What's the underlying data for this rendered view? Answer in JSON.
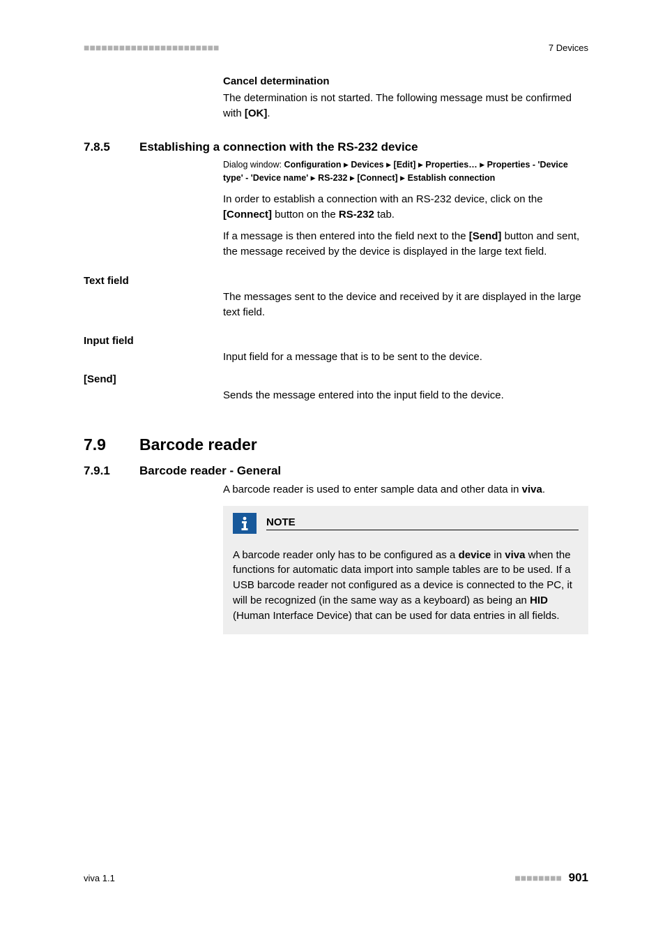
{
  "header": {
    "marks": "■■■■■■■■■■■■■■■■■■■■■■■",
    "right": "7 Devices"
  },
  "cancel": {
    "title": "Cancel determination",
    "body_before": "The determination is not started. The following message must be confirmed with ",
    "ok": "[OK]",
    "body_after": "."
  },
  "sec785": {
    "num": "7.8.5",
    "title": "Establishing a connection with the RS-232 device",
    "dialog_prefix": "Dialog window: ",
    "d1": "Configuration",
    "d2": "Devices",
    "d3": "[Edit]",
    "d4": "Properties…",
    "d5": "Properties - 'Device type' - 'Device name'",
    "d6": "RS-232",
    "d7": "[Connect]",
    "d8": "Establish connection",
    "p1_before": "In order to establish a connection with an RS-232 device, click on the ",
    "p1_connect": "[Connect]",
    "p1_mid": " button on the ",
    "p1_tab": "RS-232",
    "p1_after": " tab.",
    "p2_before": "If a message is then entered into the field next to the ",
    "p2_send": "[Send]",
    "p2_after": " button and sent, the message received by the device is displayed in the large text field."
  },
  "textfield": {
    "label": "Text field",
    "body": "The messages sent to the device and received by it are displayed in the large text field."
  },
  "inputfield": {
    "label": "Input field",
    "body": "Input field for a message that is to be sent to the device."
  },
  "send": {
    "label": "[Send]",
    "body": "Sends the message entered into the input field to the device."
  },
  "sec79": {
    "num": "7.9",
    "title": "Barcode reader"
  },
  "sec791": {
    "num": "7.9.1",
    "title": "Barcode reader - General",
    "p_before": "A barcode reader is used to enter sample data and other data in ",
    "viva": "viva",
    "p_after": "."
  },
  "note": {
    "title": "NOTE",
    "b1": "A barcode reader only has to be configured as a ",
    "device": "device",
    "b2": " in ",
    "viva": "viva",
    "b3": " when the functions for automatic data import into sample tables are to be used. If a USB barcode reader not configured as a device is connected to the PC, it will be recognized (in the same way as a keyboard) as being an ",
    "hid": "HID",
    "b4": " (Human Interface Device) that can be used for data entries in all fields."
  },
  "footer": {
    "left": "viva 1.1",
    "marks": "■■■■■■■■",
    "page": "901"
  }
}
